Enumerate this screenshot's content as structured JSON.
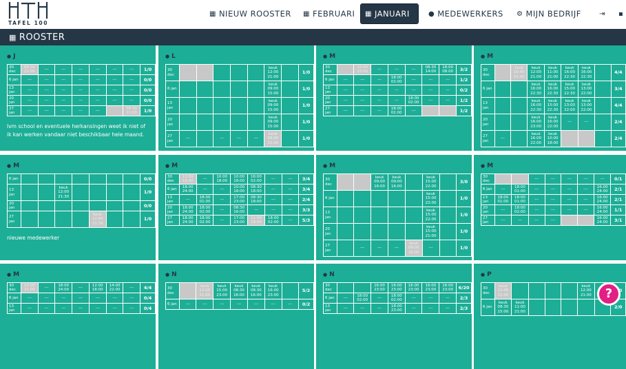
{
  "logo": {
    "mark": "HTH",
    "tagline": "TAFEL 100"
  },
  "nav": [
    {
      "label": "NIEUW ROOSTER",
      "icon": "grid-icon"
    },
    {
      "label": "FEBRUARI",
      "icon": "grid-icon"
    },
    {
      "label": "JANUARI",
      "icon": "grid-icon",
      "active": true
    },
    {
      "label": "MEDEWERKERS",
      "icon": "user-icon"
    },
    {
      "label": "MIJN BEDRIJF",
      "icon": "gear-icon"
    },
    {
      "label": "",
      "icon": "logout-icon"
    },
    {
      "label": "",
      "icon": "lock-icon"
    }
  ],
  "section": {
    "title": "ROOSTER"
  },
  "colors": {
    "card": "#1cae96",
    "header": "#253747",
    "off": "#c8c8c8",
    "help": "#e21f84"
  },
  "cards": [
    {
      "name": "J",
      "note": "Ivm school en eventuele herkansingen weet ik niet of ik kan werken vandaar niet beschikbaar hele maand.",
      "rows": [
        {
          "d": "30 dec",
          "c": [
            "o:09:30 21:00",
            "---",
            "---",
            "---",
            "---",
            "---",
            "---"
          ],
          "t": "1/0"
        },
        {
          "d": "6 jan",
          "c": [
            "---",
            "---",
            "---",
            "---",
            "---",
            "---",
            "---"
          ],
          "t": "0/0"
        },
        {
          "d": "13 jan",
          "c": [
            "---",
            "---",
            "---",
            "---",
            "---",
            "---",
            "---"
          ],
          "t": "0/0"
        },
        {
          "d": "20 jan",
          "c": [
            "---",
            "---",
            "---",
            "---",
            "---",
            "---",
            "---"
          ],
          "t": "0/0"
        },
        {
          "d": "27 jan",
          "c": [
            "---",
            "---",
            "---",
            "---",
            "---",
            "o:",
            "o:09:30 21:00"
          ],
          "t": "1/0"
        }
      ]
    },
    {
      "name": "L",
      "note": "",
      "rows": [
        {
          "d": "30 dec",
          "c": [
            "o:",
            "o:",
            "",
            "",
            "",
            "keuk 12:00 21:00",
            ""
          ],
          "t": "1/0"
        },
        {
          "d": "6 jan",
          "c": [
            "",
            "",
            "",
            "",
            "",
            "keuk 09:00 15:00",
            ""
          ],
          "t": "1/0"
        },
        {
          "d": "13 jan",
          "c": [
            "",
            "",
            "",
            "",
            "",
            "keuk 09:00 15:00",
            ""
          ],
          "t": "1/0"
        },
        {
          "d": "20 jan",
          "c": [
            "",
            "",
            "",
            "",
            "",
            "keuk 09:00 15:00",
            ""
          ],
          "t": "1/0"
        },
        {
          "d": "27 jan",
          "c": [
            "---",
            "",
            "---",
            "---",
            "---",
            "o:keuk 09:00 15:00",
            ""
          ],
          "t": "1/0"
        }
      ]
    },
    {
      "name": "M",
      "note": "",
      "rows": [
        {
          "d": "30 dec",
          "c": [
            "o:",
            "o:12:00 15:00",
            "---",
            "---",
            "---",
            "08:30 14:00",
            "18:00 08:00"
          ],
          "t": "3/2"
        },
        {
          "d": "6 jan",
          "c": [
            "---",
            "---",
            "---",
            "18:00 02:00",
            "---",
            "---",
            "---"
          ],
          "t": "1/2"
        },
        {
          "d": "13 jan",
          "c": [
            "---",
            "---",
            "---",
            "---",
            "---",
            "---",
            "---"
          ],
          "t": "0/2"
        },
        {
          "d": "20 jan",
          "c": [
            "---",
            "---",
            "---",
            "---",
            "18:00 02:00",
            "---",
            "---"
          ],
          "t": "1/2"
        },
        {
          "d": "27 jan",
          "c": [
            "---",
            "---",
            "---",
            "18:00 02:00",
            "---",
            "o:",
            "o:"
          ],
          "t": "1/2"
        }
      ]
    },
    {
      "name": "M",
      "note": "",
      "rows": [
        {
          "d": "30 dec",
          "c": [
            "o:",
            "o:keuk 16:00 21:00",
            "keuk 12:00 21:00",
            "keuk 11:00 21:00",
            "keuk 16:00 22:30",
            "keuk 16:00 22:30",
            ""
          ],
          "t": "4/4"
        },
        {
          "d": "6 jan",
          "c": [
            "",
            "",
            "keuk 16:00 22:30",
            "keuk 16:00 22:30",
            "keuk 15:00 22:30",
            "keuk 13:00 22:00",
            ""
          ],
          "t": "3/4"
        },
        {
          "d": "13 jan",
          "c": [
            "",
            "",
            "keuk 16:00 22:30",
            "keuk 15:00 22:30",
            "keuk 13:00 22:00",
            "keuk 13:00 22:00",
            ""
          ],
          "t": "4/4"
        },
        {
          "d": "20 jan",
          "c": [
            "",
            "",
            "keuk 16:00 23:00",
            "keuk 16:00 22:00",
            "---",
            "---",
            ""
          ],
          "t": "2/4"
        },
        {
          "d": "27 jan",
          "c": [
            "---",
            "",
            "keuk 16:00 22:00",
            "keuk 10:00 18:00",
            "o:",
            "o:",
            ""
          ],
          "t": "2/4"
        }
      ]
    },
    {
      "name": "M",
      "note": "nieuwe medewerker",
      "rows": [
        {
          "d": "6 jan",
          "c": [
            "",
            "",
            "",
            "",
            "",
            "",
            ""
          ],
          "t": "0/0"
        },
        {
          "d": "13 jan",
          "c": [
            "",
            "",
            "keuk 12:00 21:30",
            "",
            "",
            "",
            ""
          ],
          "t": "1/0"
        },
        {
          "d": "20 jan",
          "c": [
            "",
            "",
            "",
            "",
            "",
            "",
            ""
          ],
          "t": "0/0"
        },
        {
          "d": "27 jan",
          "c": [
            "",
            "",
            "",
            "",
            "o:keuk 12:00 21:30",
            "",
            ""
          ],
          "t": "1/0"
        }
      ]
    },
    {
      "name": "M",
      "note": "",
      "rows": [
        {
          "d": "30 dec",
          "c": [
            "o:11:00 18:00",
            "---",
            "10:00 18:00",
            "10:00 18:00",
            "16:00 02:00",
            "---",
            "---"
          ],
          "t": "3/4"
        },
        {
          "d": "6 jan",
          "c": [
            "18:00 24:00",
            "---",
            "---",
            "10:00 18:00",
            "08:30 18:00",
            "---",
            "---"
          ],
          "t": "3/4"
        },
        {
          "d": "13 jan",
          "c": [
            "---",
            "18:00 01:00",
            "---",
            "17:00 23:00",
            "08:30 18:00",
            "---",
            "---"
          ],
          "t": "2/4"
        },
        {
          "d": "20 jan",
          "c": [
            "18:00 24:00",
            "18:00 02:00",
            "---",
            "08:30 16:00",
            "---",
            "---",
            "---"
          ],
          "t": "3/3"
        },
        {
          "d": "27 jan",
          "c": [
            "18:00 24:00",
            "18:00 02:00",
            "---",
            "17:00 23:00",
            "o:11:00 18:00",
            "18:00 02:00",
            "---"
          ],
          "t": "5/3"
        }
      ]
    },
    {
      "name": "M",
      "note": "",
      "rows": [
        {
          "d": "30 dec",
          "c": [
            "o:",
            "o:",
            "keuk 09:00 16:00",
            "keuk 09:00 16:00",
            "",
            "keuk 15:00 22:00",
            ""
          ],
          "t": "3/0"
        },
        {
          "d": "6 jan",
          "c": [
            "",
            "",
            "",
            "",
            "",
            "keuk 15:00 22:00",
            ""
          ],
          "t": "1/0"
        },
        {
          "d": "13 jan",
          "c": [
            "",
            "",
            "",
            "",
            "",
            "keuk 15:00 22:00",
            ""
          ],
          "t": "1/0"
        },
        {
          "d": "20 jan",
          "c": [
            "",
            "",
            "",
            "",
            "",
            "keuk 15:00 21:00",
            ""
          ],
          "t": "1/0"
        },
        {
          "d": "27 jan",
          "c": [
            "",
            "---",
            "---",
            "---",
            "o:keuk 09:00 16:00",
            "---",
            ""
          ],
          "t": "1/0"
        }
      ]
    },
    {
      "name": "M",
      "note": "",
      "rows": [
        {
          "d": "30 dec",
          "c": [
            "o:",
            "o:",
            "---",
            "---",
            "---",
            "---",
            "---"
          ],
          "t": "0/1"
        },
        {
          "d": "6 jan",
          "c": [
            "---",
            "18:00 01:00",
            "---",
            "---",
            "---",
            "---",
            "16:00 24:00"
          ],
          "t": "2/1"
        },
        {
          "d": "13 jan",
          "c": [
            "18:00 01:00",
            "18:00 01:00",
            "---",
            "---",
            "---",
            "---",
            "16:00 24:00"
          ],
          "t": "2/1"
        },
        {
          "d": "20 jan",
          "c": [
            "---",
            "18:00 02:00",
            "---",
            "---",
            "---",
            "---",
            "16:00 24:00"
          ],
          "t": "1/1"
        },
        {
          "d": "27 jan",
          "c": [
            "---",
            "---",
            "---",
            "---",
            "o:",
            "o:",
            "16:00 24:00"
          ],
          "t": "3/1"
        }
      ]
    },
    {
      "name": "M",
      "note": "",
      "rows": [
        {
          "d": "30 dec",
          "c": [
            "o:12:00 21:00",
            "---",
            "18:00 24:00",
            "---",
            "12:00 18:00",
            "14:00 22:00",
            "---"
          ],
          "t": "4/4"
        },
        {
          "d": "6 jan",
          "c": [
            "---",
            "---",
            "---",
            "---",
            "---",
            "---",
            "---"
          ],
          "t": "0/4"
        },
        {
          "d": "13 jan",
          "c": [
            "---",
            "---",
            "---",
            "---",
            "---",
            "---",
            "---"
          ],
          "t": "0/4"
        }
      ]
    },
    {
      "name": "N",
      "note": "",
      "rows": [
        {
          "d": "30 dec",
          "c": [
            "o:",
            "o:keuk 12:00 21:00",
            "keuk 15:00 23:00",
            "keuk 08:30 16:00",
            "keuk 08:30 16:00",
            "keuk 16:00 23:00",
            ""
          ],
          "t": "5/2"
        },
        {
          "d": "6 jan",
          "c": [
            "---",
            "---",
            "---",
            "---",
            "---",
            "---",
            "---"
          ],
          "t": "0/2"
        }
      ]
    },
    {
      "name": "N",
      "note": "",
      "rows": [
        {
          "d": "30 dec",
          "c": [
            "",
            "",
            "16:00 23:00",
            "16:00 23:00",
            "16:00 23:00",
            "16:00 23:00",
            "16:00 23:00"
          ],
          "t": "6/20"
        },
        {
          "d": "6 jan",
          "c": [
            "---",
            "18:00 02:00",
            "---",
            "18:00 02:00",
            "---",
            "---",
            "---"
          ],
          "t": "2/3"
        },
        {
          "d": "13 jan",
          "c": [
            "---",
            "---",
            "---",
            "18:00 23:00",
            "---",
            "---",
            "---"
          ],
          "t": "2/3"
        }
      ]
    },
    {
      "name": "P",
      "note": "",
      "rows": [
        {
          "d": "30 dec",
          "c": [
            "o:keuk 12:00 21:00",
            "",
            "",
            "",
            "",
            "keuk 12:00 21:00",
            ""
          ],
          "t": "2/0"
        },
        {
          "d": "6 jan",
          "c": [
            "keuk 08:30 15:00",
            "keuk 11:00 21:00",
            "",
            "",
            "",
            "",
            ""
          ],
          "t": "2/0"
        }
      ]
    }
  ],
  "help": {
    "label": "?"
  }
}
